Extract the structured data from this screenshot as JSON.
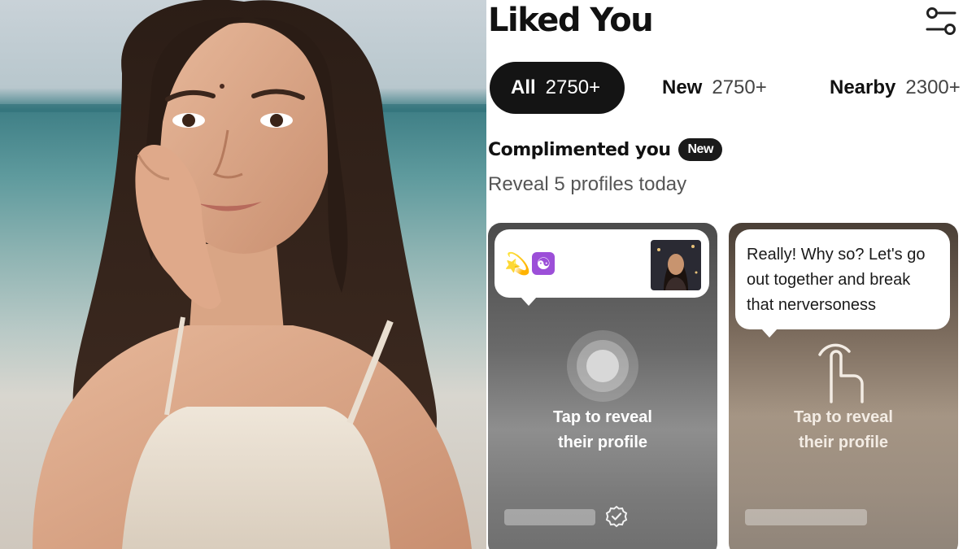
{
  "header": {
    "title": "Liked You"
  },
  "tabs": [
    {
      "label": "All",
      "count": "2750+",
      "active": true
    },
    {
      "label": "New",
      "count": "2750+",
      "active": false
    },
    {
      "label": "Nearby",
      "count": "2300+",
      "active": false
    }
  ],
  "section": {
    "title": "Complimented you",
    "badge": "New",
    "subtitle": "Reveal 5 profiles today"
  },
  "cards": [
    {
      "emojis": [
        "💫",
        "☯"
      ],
      "reveal_line1": "Tap to reveal",
      "reveal_line2": "their profile",
      "reveal_icon": "circle-tap-icon",
      "verified_icon": "verified-badge-icon"
    },
    {
      "message": "Really! Why so? Let's go out together and break that nerversoness",
      "reveal_line1": "Tap to reveal",
      "reveal_line2": "their profile",
      "reveal_icon": "hand-tap-icon"
    }
  ],
  "icons": {
    "filter": "filter-sliders-icon"
  },
  "colors": {
    "active_tab_bg": "#141414",
    "badge_bg": "#1a1a1a",
    "card1_bg": "#6a6a6a",
    "card2_bg": "#a59584"
  }
}
